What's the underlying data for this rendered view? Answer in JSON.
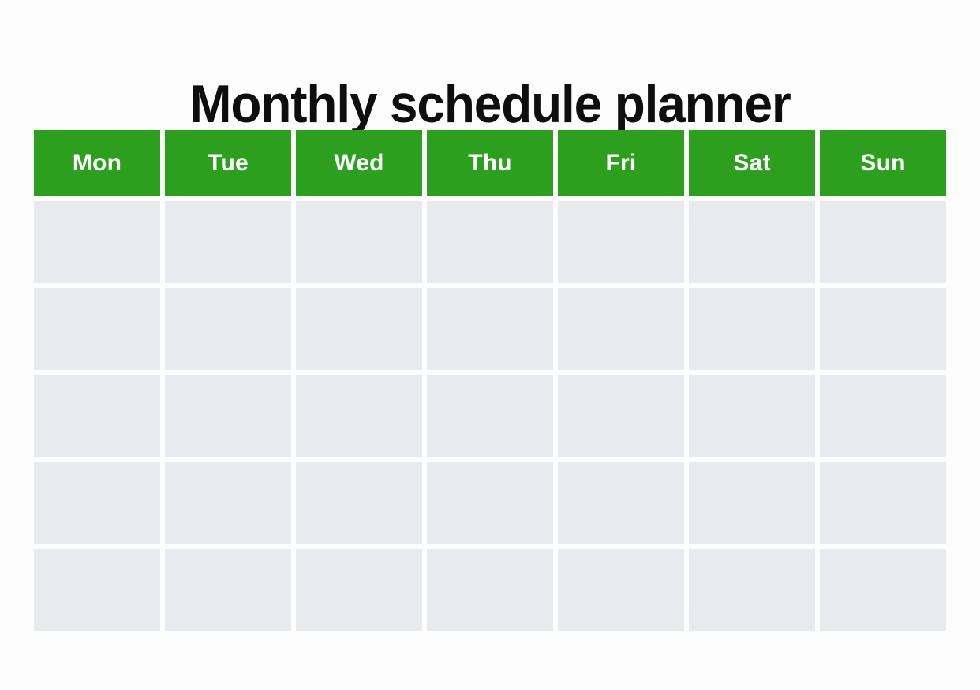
{
  "document": {
    "title": "Monthly schedule planner",
    "background_color": "#FDFDFD"
  },
  "theme": {
    "header_color": "#2CA01E",
    "header_text_color": "#FFFFFF",
    "cell_color": "#E9EAEE",
    "title_color": "#0E0E0E",
    "gap_color": "#FFFFFF"
  },
  "calendar": {
    "weekday_headers": [
      {
        "label": "Mon"
      },
      {
        "label": "Tue"
      },
      {
        "label": "Wed"
      },
      {
        "label": "Thu"
      },
      {
        "label": "Fri"
      },
      {
        "label": "Sat"
      },
      {
        "label": "Sun"
      }
    ],
    "week_count": 5,
    "column_count": 7,
    "weeks": [
      {
        "days": [
          {
            "number": "",
            "note": ""
          },
          {
            "number": "",
            "note": ""
          },
          {
            "number": "",
            "note": ""
          },
          {
            "number": "",
            "note": ""
          },
          {
            "number": "",
            "note": ""
          },
          {
            "number": "",
            "note": ""
          },
          {
            "number": "",
            "note": ""
          }
        ]
      },
      {
        "days": [
          {
            "number": "",
            "note": ""
          },
          {
            "number": "",
            "note": ""
          },
          {
            "number": "",
            "note": ""
          },
          {
            "number": "",
            "note": ""
          },
          {
            "number": "",
            "note": ""
          },
          {
            "number": "",
            "note": ""
          },
          {
            "number": "",
            "note": ""
          }
        ]
      },
      {
        "days": [
          {
            "number": "",
            "note": ""
          },
          {
            "number": "",
            "note": ""
          },
          {
            "number": "",
            "note": ""
          },
          {
            "number": "",
            "note": ""
          },
          {
            "number": "",
            "note": ""
          },
          {
            "number": "",
            "note": ""
          },
          {
            "number": "",
            "note": ""
          }
        ]
      },
      {
        "days": [
          {
            "number": "",
            "note": ""
          },
          {
            "number": "",
            "note": ""
          },
          {
            "number": "",
            "note": ""
          },
          {
            "number": "",
            "note": ""
          },
          {
            "number": "",
            "note": ""
          },
          {
            "number": "",
            "note": ""
          },
          {
            "number": "",
            "note": ""
          }
        ]
      },
      {
        "days": [
          {
            "number": "",
            "note": ""
          },
          {
            "number": "",
            "note": ""
          },
          {
            "number": "",
            "note": ""
          },
          {
            "number": "",
            "note": ""
          },
          {
            "number": "",
            "note": ""
          },
          {
            "number": "",
            "note": ""
          },
          {
            "number": "",
            "note": ""
          }
        ]
      }
    ]
  }
}
